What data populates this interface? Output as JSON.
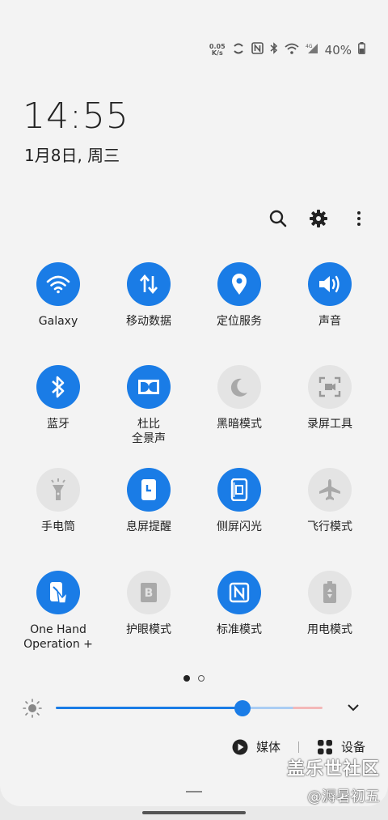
{
  "status_bar": {
    "net_speed_value": "0.05",
    "net_speed_unit": "K/s",
    "battery_percent": "40%"
  },
  "clock": {
    "time": "14:55",
    "date": "1月8日, 周三"
  },
  "tiles": [
    {
      "label": "Galaxy",
      "icon": "wifi-icon",
      "active": true
    },
    {
      "label": "移动数据",
      "icon": "mobile-data-icon",
      "active": true
    },
    {
      "label": "定位服务",
      "icon": "location-icon",
      "active": true
    },
    {
      "label": "声音",
      "icon": "sound-icon",
      "active": true
    },
    {
      "label": "蓝牙",
      "icon": "bluetooth-icon",
      "active": true
    },
    {
      "label": "杜比\n全景声",
      "icon": "dolby-icon",
      "active": true
    },
    {
      "label": "黑暗模式",
      "icon": "moon-icon",
      "active": false
    },
    {
      "label": "录屏工具",
      "icon": "screen-record-icon",
      "active": false
    },
    {
      "label": "手电筒",
      "icon": "flashlight-icon",
      "active": false
    },
    {
      "label": "息屏提醒",
      "icon": "always-on-display-icon",
      "active": true
    },
    {
      "label": "侧屏闪光",
      "icon": "edge-lighting-icon",
      "active": true
    },
    {
      "label": "飞行模式",
      "icon": "airplane-icon",
      "active": false
    },
    {
      "label": "One Hand\nOperation +",
      "icon": "one-hand-icon",
      "active": true
    },
    {
      "label": "护眼模式",
      "icon": "eye-comfort-icon",
      "active": false
    },
    {
      "label": "标准模式",
      "icon": "nfc-icon",
      "active": true
    },
    {
      "label": "用电模式",
      "icon": "power-mode-icon",
      "active": false
    }
  ],
  "brightness": {
    "level": 0.7
  },
  "bottom": {
    "media_label": "媒体",
    "devices_label": "设备"
  },
  "watermark": {
    "line1": "盖乐世社区",
    "line2": "@溽暑初五"
  },
  "colors": {
    "accent": "#1a7ce6",
    "tile_off": "#e4e4e4",
    "panel_bg": "#f3f3f3"
  }
}
